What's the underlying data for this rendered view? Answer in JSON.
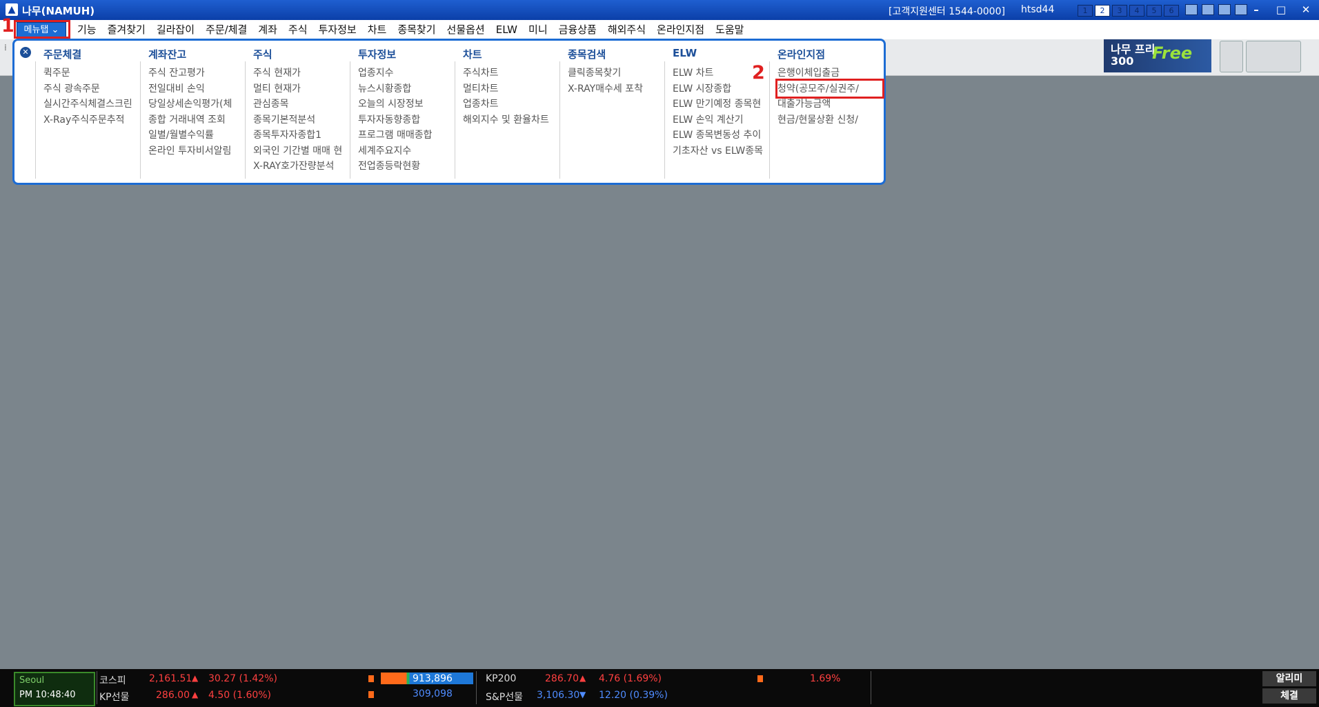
{
  "window": {
    "title": "나무(NAMUH)",
    "support": "[고객지원센터 1544-0000]",
    "user_id": "htsd44",
    "screen_slots": [
      "1",
      "2",
      "3",
      "4",
      "5",
      "6"
    ],
    "controls": [
      "–",
      "□",
      "✕"
    ]
  },
  "menubar": {
    "menutab": "메뉴탭 ⌄",
    "items": [
      "기능",
      "즐겨찾기",
      "길라잡이",
      "주문/체결",
      "계좌",
      "주식",
      "투자정보",
      "차트",
      "종목찾기",
      "선물옵션",
      "ELW",
      "미니",
      "금융상품",
      "해외주식",
      "온라인지점",
      "도움말"
    ]
  },
  "banner": {
    "name": "나무 프리300",
    "free": "Free"
  },
  "menu_panel": {
    "columns": [
      {
        "header": "주문체결",
        "items": [
          "퀵주문",
          "주식 광속주문",
          "실시간주식체결스크린",
          "X-Ray주식주문추적"
        ]
      },
      {
        "header": "계좌잔고",
        "items": [
          "주식 잔고평가",
          "전일대비 손익",
          "당일상세손익평가(체",
          "종합 거래내역 조회",
          "일별/월별수익률",
          "온라인 투자비서알림"
        ]
      },
      {
        "header": "주식",
        "items": [
          "주식 현재가",
          "멀티 현재가",
          "관심종목",
          "종목기본적분석",
          "종목투자자종합1",
          "외국인 기간별 매매 현",
          "X-RAY호가잔량분석"
        ]
      },
      {
        "header": "투자정보",
        "items": [
          "업종지수",
          "뉴스시황종합",
          "오늘의 시장정보",
          "투자자동향종합",
          "프로그램 매매종합",
          "세계주요지수",
          "전업종등락현황"
        ]
      },
      {
        "header": "차트",
        "items": [
          "주식차트",
          "멀티차트",
          "업종차트",
          "해외지수 및 환율차트"
        ]
      },
      {
        "header": "종목검색",
        "items": [
          "클릭종목찾기",
          "X-RAY매수세 포착"
        ]
      },
      {
        "header": "ELW",
        "items": [
          "ELW 차트",
          "ELW 시장종합",
          "ELW 만기예정 종목현",
          "ELW 손익 계산기",
          "ELW 종목변동성 추이",
          "기초자산 vs ELW종목"
        ]
      },
      {
        "header": "온라인지점",
        "items": [
          "은행이체입출금",
          "청약(공모주/실권주/",
          "대출가능금액",
          "현금/현물상환 신청/"
        ]
      }
    ]
  },
  "annotations": {
    "label_1": "1",
    "label_2": "2"
  },
  "statusbar": {
    "city": "Seoul",
    "clock": "PM 10:48:40",
    "kospi_label": "코스피",
    "kospi_value": "2,161.51",
    "kospi_change": "30.27 (1.42%)",
    "kpfut_label": "KP선물",
    "kpfut_value": "286.00",
    "kpfut_change": "4.50 (1.60%)",
    "volume1": "913,896",
    "volume2": "309,098",
    "kp200_label": "KP200",
    "kp200_value": "286.70",
    "kp200_change": "4.76 (1.69%)",
    "sp_label": "S&P선물",
    "sp_value": "3,106.30",
    "sp_change": "12.20 (0.39%)",
    "pct": "1.69%",
    "alarm": "알리미",
    "exec": "체결"
  }
}
